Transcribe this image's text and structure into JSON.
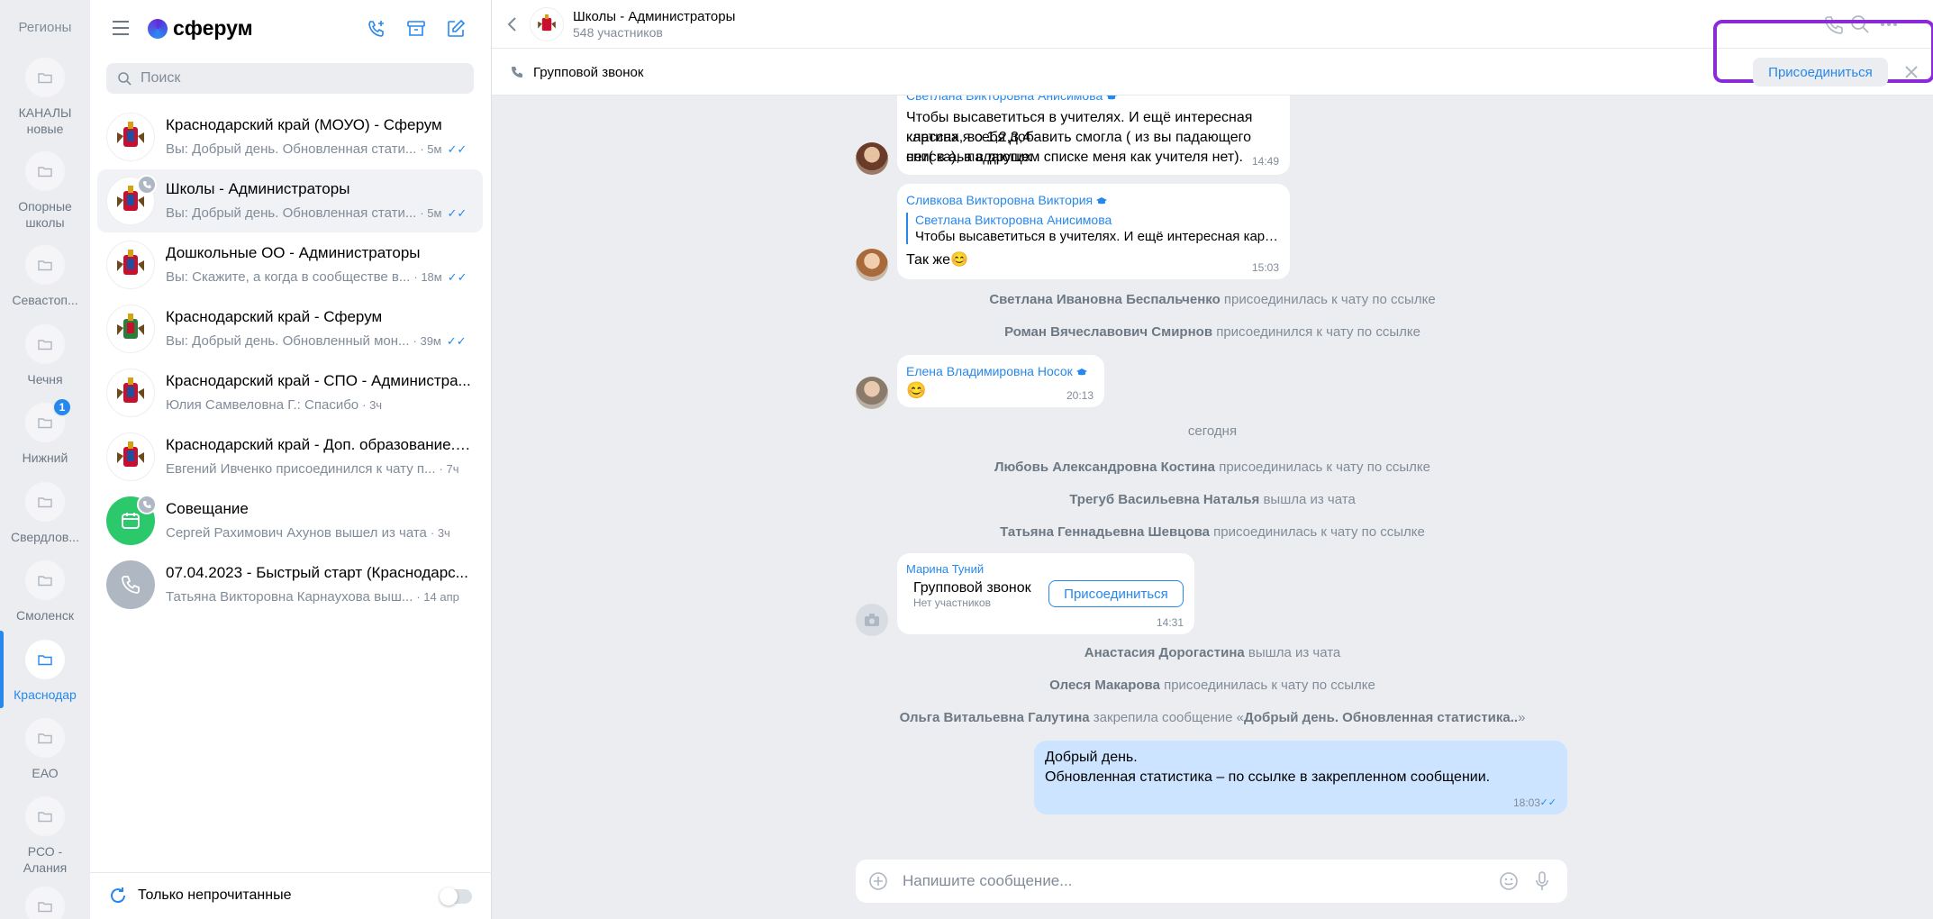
{
  "rail": {
    "title": "Регионы",
    "folders": [
      {
        "label": "КАНАЛЫ\nновые"
      },
      {
        "label": "Опорные\nшколы"
      },
      {
        "label": "Севастоп..."
      },
      {
        "label": "Чечня"
      },
      {
        "label": "Нижний",
        "badge": "1"
      },
      {
        "label": "Свердлов..."
      },
      {
        "label": "Смоленск"
      },
      {
        "label": "Краснодар"
      },
      {
        "label": "ЕАО"
      },
      {
        "label": "РСО -\nАлания"
      }
    ]
  },
  "list": {
    "brand": "сферум",
    "search_placeholder": "Поиск",
    "chats": [
      {
        "title": "Краснодарский край (МОУО) - Сферум",
        "preview": "Вы: Добрый день. Обновленная стати...",
        "time": "· 5м",
        "read": "✓✓"
      },
      {
        "title": "Школы - Администраторы",
        "preview": "Вы: Добрый день. Обновленная стати...",
        "time": "· 5м",
        "read": "✓✓"
      },
      {
        "title": "Дошкольные ОО - Администраторы",
        "preview": "Вы: Скажите, а когда в сообществе в...",
        "time": "· 18м",
        "read": "✓✓"
      },
      {
        "title": "Краснодарский край - Сферум",
        "preview": "Вы: Добрый день. Обновленный мон...",
        "time": "· 39м",
        "read": "✓✓"
      },
      {
        "title": "Краснодарский край - СПО - Администра...",
        "preview": "Юлия Самвеловна Г.: Спасибо",
        "time": "· 3ч",
        "read": ""
      },
      {
        "title": "Краснодарский край - Доп. образование. ...",
        "preview": "Евгений Ивченко присоединился к чату п...",
        "time": "· 7ч",
        "read": ""
      },
      {
        "title": "Совещание",
        "preview": "Сергей Рахимович Ахунов вышел из чата",
        "time": "· 3ч",
        "read": ""
      },
      {
        "title": "07.04.2023 - Быстрый старт (Краснодарс...",
        "preview": "Татьяна Викторовна Карнаухова выш...",
        "time": "· 14 апр",
        "read": ""
      }
    ],
    "unread_only_label": "Только непрочитанные"
  },
  "main": {
    "title": "Школы - Администраторы",
    "members": "548 участников",
    "callbar_label": "Групповой звонок",
    "join_label": "Присоединиться",
    "messages": {
      "m1_author": "Светлана Викторовна Анисимова",
      "m1_line1": "Чтобы высаветиться в учителях. И ещё интересная картина, во 1,2,3,4",
      "m1_line2": "классах я себя добавить смогла ( из вы падающего списка), а в других",
      "m1_line3": "нет( в аыпадающем списке меня как учителя нет).",
      "m1_time": "14:49",
      "m2_author": "Сливкова Викторовна Виктория",
      "m2_reply_name": "Светлана Викторовна Анисимова",
      "m2_reply_text": "Чтобы высаветиться в учителях. И ещё интересная картина, во 1,2,3,4 кла...",
      "m2_text": "Так же😊",
      "m2_time": "15:03",
      "s1_name": "Светлана Ивановна Беспальченко",
      "s1_action": " присоединилась к чату по ссылке",
      "s2_name": "Роман Вячеславович Смирнов",
      "s2_action": " присоединился к чату по ссылке",
      "m3_author": "Елена Владимировна Носок",
      "m3_text": "😊",
      "m3_time": "20:13",
      "date_divider": "сегодня",
      "s3_name": "Любовь Александровна Костина",
      "s3_action": " присоединилась к чату по ссылке",
      "s4_name": "Трегуб Васильевна Наталья",
      "s4_action": " вышла из чата",
      "s5_name": "Татьяна Геннадьевна Шевцова",
      "s5_action": " присоединилась к чату по ссылке",
      "m4_author": "Марина Туний",
      "m4_call_title": "Групповой звонок",
      "m4_call_sub": "Нет участников",
      "m4_join": "Присоединиться",
      "m4_time": "14:31",
      "s6_name": "Анастасия Дорогастина",
      "s6_action": " вышла из чата",
      "s7_name": "Олеся Макарова",
      "s7_action": " присоединилась к чату по ссылке",
      "s8_name": "Ольга Витальевна Галутина",
      "s8_action": " закрепила сообщение «",
      "s8_pinned": "Добрый день. Обновленная статистика..",
      "s8_close": "»",
      "m5_line1": "Добрый день.",
      "m5_line2": "Обновленная статистика – по ссылке в закрепленном сообщении.",
      "m5_time": "18:03",
      "m5_read": "✓✓"
    },
    "composer_placeholder": "Напишите сообщение..."
  },
  "colors": {
    "accent": "#2688eb",
    "highlight": "#8b2ad8",
    "outgoing_bubble": "#cce4ff",
    "chat_bg": "#ebedf0"
  }
}
